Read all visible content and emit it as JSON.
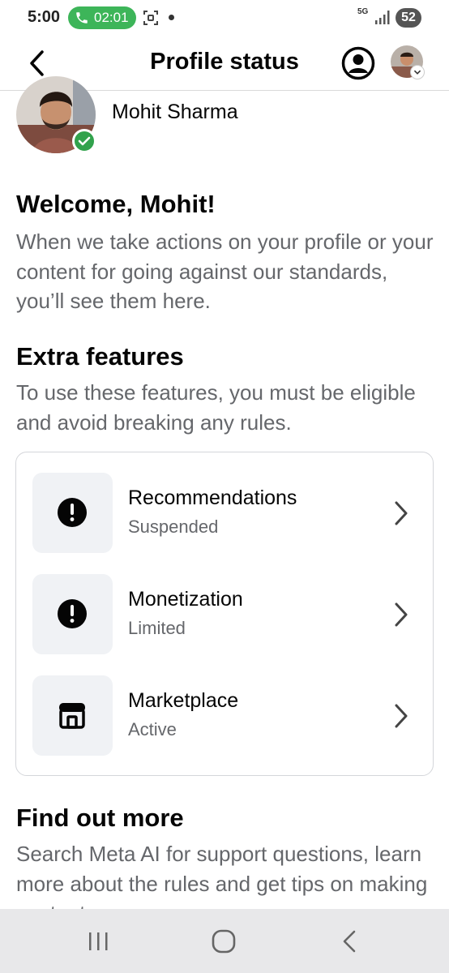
{
  "status_bar": {
    "time": "5:00",
    "call_timer": "02:01",
    "network": "5G",
    "battery": "52"
  },
  "header": {
    "title": "Profile status"
  },
  "profile": {
    "name": "Mohit Sharma"
  },
  "welcome": {
    "heading": "Welcome, Mohit!",
    "body": "When we take actions on your profile or your content for going against our standards, you’ll see them here."
  },
  "extra_features": {
    "heading": "Extra features",
    "body": "To use these features, you must be eligible and avoid breaking any rules.",
    "items": [
      {
        "title": "Recommendations",
        "status": "Suspended",
        "icon": "alert-icon"
      },
      {
        "title": "Monetization",
        "status": "Limited",
        "icon": "alert-icon"
      },
      {
        "title": "Marketplace",
        "status": "Active",
        "icon": "shop-icon"
      }
    ]
  },
  "find_out_more": {
    "heading": "Find out more",
    "body": "Search Meta AI for support questions, learn more about the rules and get tips on making content"
  },
  "colors": {
    "call_green": "#3db559",
    "verified_green": "#31a24c",
    "secondary_text": "#65676b",
    "icon_box_bg": "#f0f2f5"
  },
  "nav_bar": {
    "buttons": [
      "recents-icon",
      "home-icon",
      "back-icon"
    ]
  }
}
